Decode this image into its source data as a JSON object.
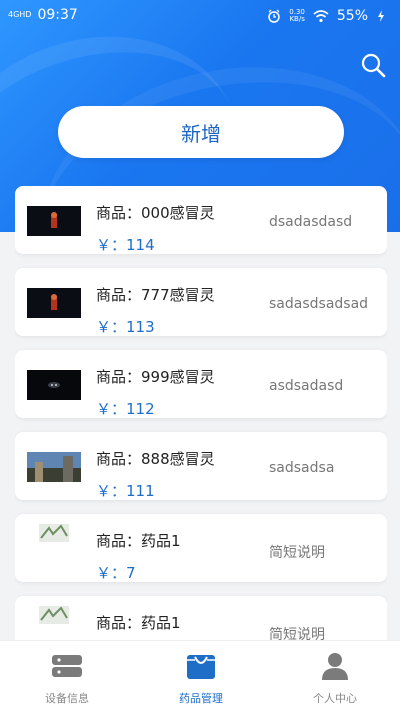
{
  "status": {
    "network": "4GHD",
    "time": "09:37",
    "speed_value": "0.30",
    "speed_unit": "KB/s",
    "battery": "55%"
  },
  "header": {
    "add_button_label": "新增"
  },
  "products": [
    {
      "name": "商品：000感冒灵",
      "price": "￥：114",
      "desc": "dsadasdasd"
    },
    {
      "name": "商品：777感冒灵",
      "price": "￥：113",
      "desc": "sadasdsadsad"
    },
    {
      "name": "商品：999感冒灵",
      "price": "￥：112",
      "desc": "asdsadasd"
    },
    {
      "name": "商品：888感冒灵",
      "price": "￥：111",
      "desc": "sadsadsa"
    },
    {
      "name": "商品：药品1",
      "price": "￥：7",
      "desc": "简短说明"
    },
    {
      "name": "商品：药品1",
      "price": "",
      "desc": "简短说明"
    }
  ],
  "tabs": [
    {
      "label": "设备信息",
      "icon": "device-icon",
      "active": false
    },
    {
      "label": "药品管理",
      "icon": "medicine-bag-icon",
      "active": true
    },
    {
      "label": "个人中心",
      "icon": "person-icon",
      "active": false
    }
  ],
  "colors": {
    "primary": "#1e6ec8",
    "hero": "#1a77f0"
  }
}
